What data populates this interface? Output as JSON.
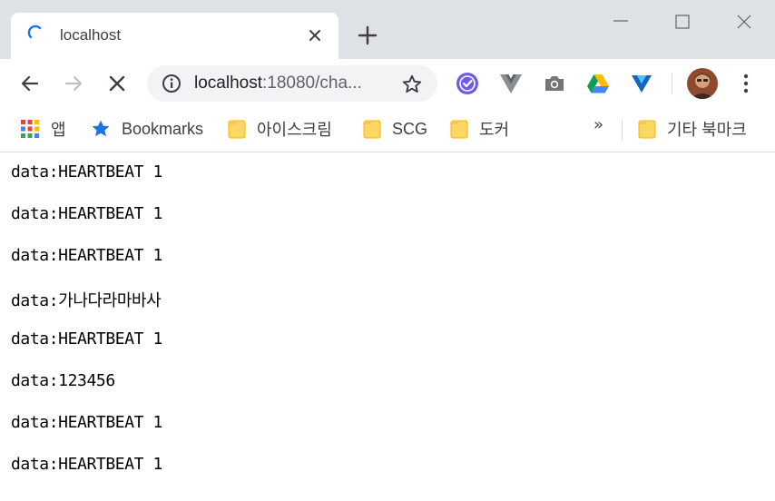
{
  "tab": {
    "title": "localhost",
    "spinner_icon": "loading-spinner-icon",
    "close_icon": "close-icon",
    "new_tab_icon": "plus-icon"
  },
  "window_controls": {
    "minimize_icon": "minimize-icon",
    "maximize_icon": "maximize-icon",
    "close_icon": "close-icon"
  },
  "toolbar": {
    "back_icon": "arrow-left-icon",
    "forward_icon": "arrow-right-icon",
    "stop_icon": "close-icon",
    "omnibox": {
      "host": "localhost",
      "rest": ":18080/cha...",
      "info_icon": "info-icon",
      "star_icon": "star-outline-icon"
    },
    "extensions": [
      "check-badge-icon",
      "vue-devtools-icon",
      "camera-icon",
      "google-drive-icon",
      "y-icon"
    ],
    "menu_icon": "kebab-menu-icon"
  },
  "bookmarks": {
    "apps_label": "앱",
    "items": [
      {
        "label": "Bookmarks",
        "icon": "star-icon"
      },
      {
        "label": "아이스크림",
        "icon": "folder-icon"
      },
      {
        "label": "SCG",
        "icon": "folder-icon"
      },
      {
        "label": "도커",
        "icon": "folder-icon"
      }
    ],
    "overflow_label": "»",
    "other_label": "기타 북마크"
  },
  "colors": {
    "tabstrip": "#dee1e6",
    "accent_blue": "#1a73e8",
    "omnibox_bg": "#f1f3f4",
    "folder_yellow": "#fdd663"
  },
  "content": {
    "lines": [
      "data:HEARTBEAT 1",
      "data:HEARTBEAT 1",
      "data:HEARTBEAT 1",
      "data:가나다라마바사",
      "data:HEARTBEAT 1",
      "data:123456",
      "data:HEARTBEAT 1",
      "data:HEARTBEAT 1"
    ]
  }
}
